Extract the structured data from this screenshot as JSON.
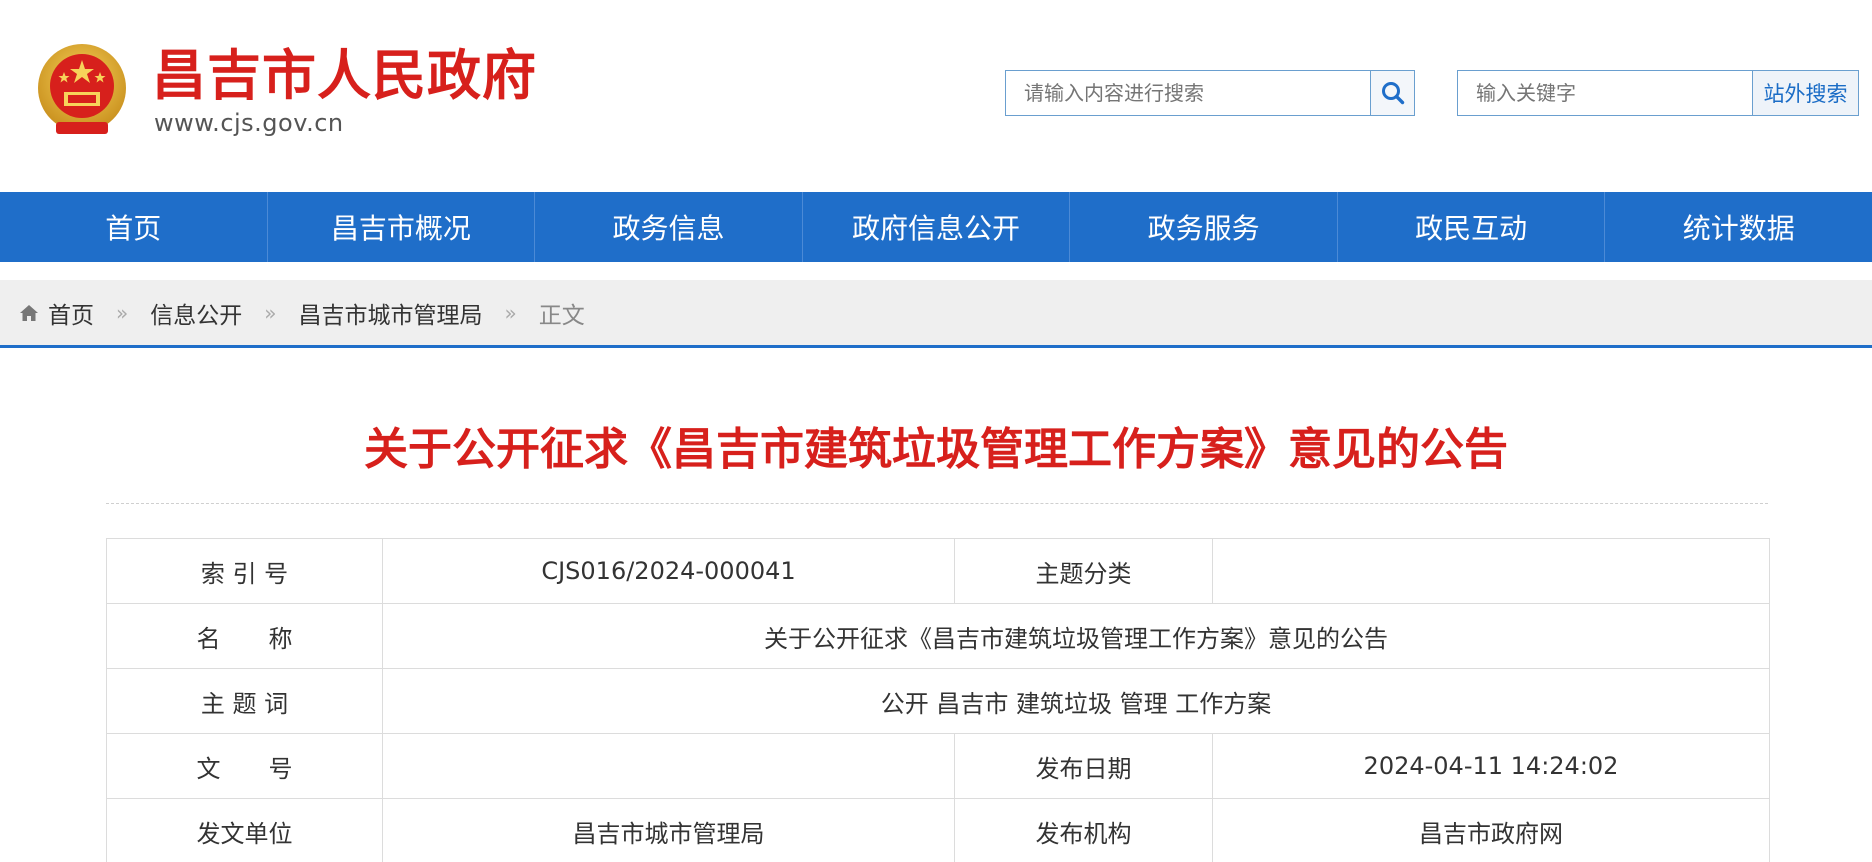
{
  "header": {
    "site_title": "昌吉市人民政府",
    "site_url": "www.cjs.gov.cn",
    "emblem_icon": "national-emblem-icon",
    "search_main": {
      "placeholder": "请输入内容进行搜索",
      "icon": "search-icon"
    },
    "search_external": {
      "placeholder": "输入关键字",
      "button_label": "站外搜索"
    }
  },
  "nav": {
    "items": [
      "首页",
      "昌吉市概况",
      "政务信息",
      "政府信息公开",
      "政务服务",
      "政民互动",
      "统计数据"
    ]
  },
  "breadcrumb": {
    "home_icon": "home-icon",
    "items": [
      "首页",
      "信息公开",
      "昌吉市城市管理局",
      "正文"
    ],
    "separator": "»"
  },
  "article": {
    "title": "关于公开征求《昌吉市建筑垃圾管理工作方案》意见的公告"
  },
  "info": {
    "index_label": "索 引 号",
    "index_value": "CJS016/2024-000041",
    "topic_label": "主题分类",
    "topic_value": "",
    "name_label": "名　　称",
    "name_value": "关于公开征求《昌吉市建筑垃圾管理工作方案》意见的公告",
    "keywords_label": "主 题 词",
    "keywords_value": "公开 昌吉市 建筑垃圾 管理 工作方案",
    "docno_label": "文　　号",
    "docno_value": "",
    "date_label": "发布日期",
    "date_value": "2024-04-11 14:24:02",
    "issuer_label": "发文单位",
    "issuer_value": "昌吉市城市管理局",
    "publisher_label": "发布机构",
    "publisher_value": "昌吉市政府网"
  },
  "colors": {
    "brand_red": "#d7201c",
    "nav_blue": "#1f6ec9"
  }
}
